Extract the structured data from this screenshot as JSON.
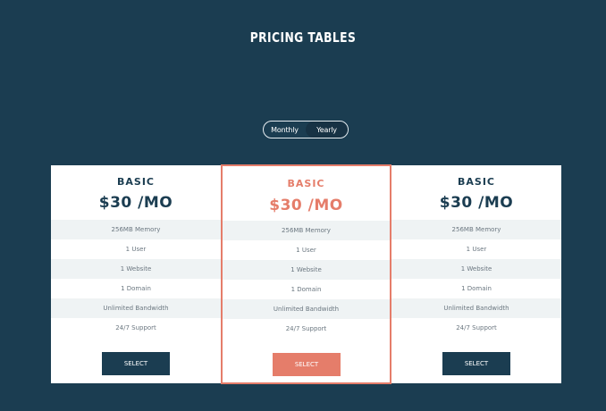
{
  "page": {
    "title": "PRICING TABLES"
  },
  "toggle": {
    "options": [
      "Monthly",
      "Yearly"
    ],
    "selected": "Yearly"
  },
  "plans": [
    {
      "tier": "BASIC",
      "price": "$30 /MO",
      "features": [
        "256MB Memory",
        "1 User",
        "1 Website",
        "1 Domain",
        "Unlimited Bandwidth",
        "24/7 Support"
      ],
      "button": "SELECT"
    },
    {
      "tier": "BASIC",
      "price": "$30 /MO",
      "features": [
        "256MB Memory",
        "1 User",
        "1 Website",
        "1 Domain",
        "Unlimited Bandwidth",
        "24/7 Support"
      ],
      "button": "SELECT"
    },
    {
      "tier": "BASIC",
      "price": "$30 /MO",
      "features": [
        "256MB Memory",
        "1 User",
        "1 Website",
        "1 Domain",
        "Unlimited Bandwidth",
        "24/7 Support"
      ],
      "button": "SELECT"
    }
  ],
  "colors": {
    "background": "#1b3d51",
    "accent": "#e57d6a",
    "card": "#ffffff",
    "row_shade": "#eff3f4"
  }
}
